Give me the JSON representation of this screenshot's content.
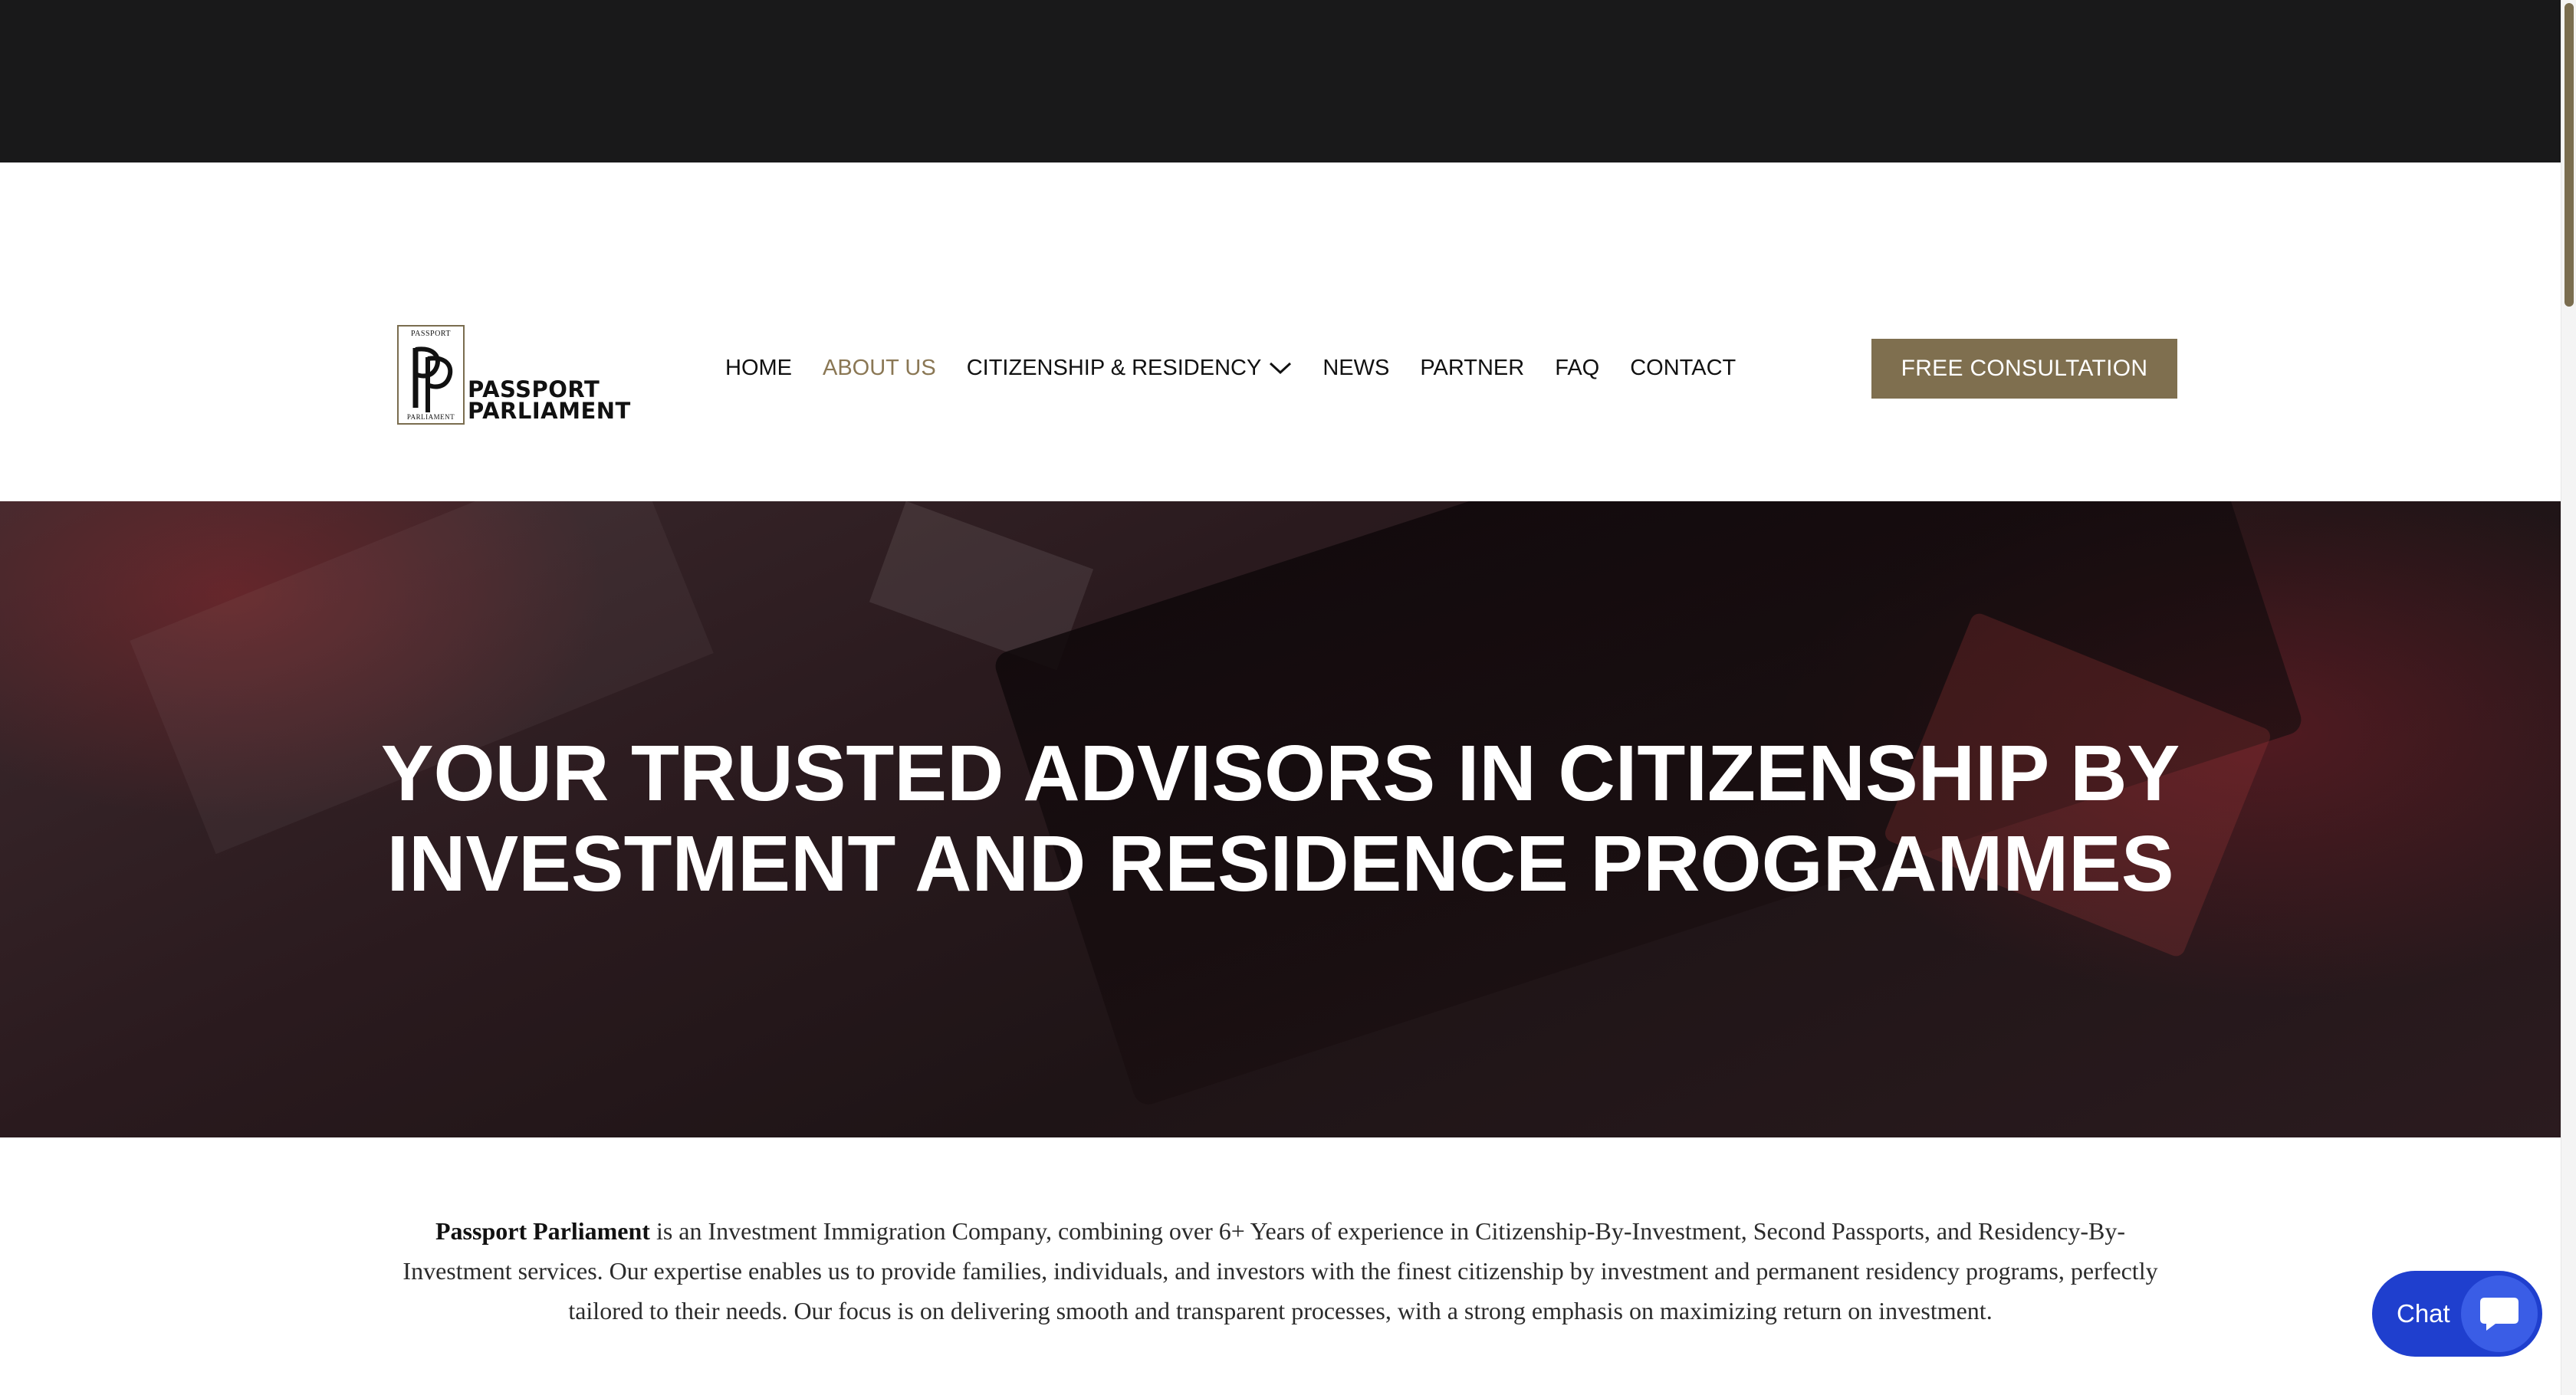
{
  "logo": {
    "box_top": "PASSPORT",
    "box_bottom": "PARLIAMENT",
    "word1": "PASSPORT",
    "word2": "PARLIAMENT"
  },
  "nav": {
    "items": [
      {
        "label": "HOME",
        "active": false
      },
      {
        "label": "ABOUT US",
        "active": true
      },
      {
        "label": "CITIZENSHIP & RESIDENCY",
        "active": false,
        "dropdown": true
      },
      {
        "label": "NEWS",
        "active": false
      },
      {
        "label": "PARTNER",
        "active": false
      },
      {
        "label": "FAQ",
        "active": false
      },
      {
        "label": "CONTACT",
        "active": false
      }
    ],
    "cta_label": "FREE CONSULTATION"
  },
  "hero": {
    "title_line1": "YOUR TRUSTED ADVISORS IN CITIZENSHIP BY",
    "title_line2": "INVESTMENT AND RESIDENCE PROGRAMMES"
  },
  "intro": {
    "company": "Passport Parliament",
    "text": " is an Investment Immigration Company, combining over 6+ Years of experience in Citizenship-By-Investment, Second Passports, and Residency-By-Investment services. Our expertise enables us to provide families, individuals, and investors with the finest citizenship by investment and permanent residency programs, perfectly tailored to their needs. Our focus is on delivering smooth and transparent processes, with a strong emphasis on maximizing return on investment."
  },
  "chat": {
    "label": "Chat",
    "icon": "chat-bubble-icon"
  },
  "colors": {
    "accent": "#7f6f4f",
    "active_nav": "#8a7754",
    "top_bar": "#19191a",
    "chat": "#1f3fce"
  }
}
